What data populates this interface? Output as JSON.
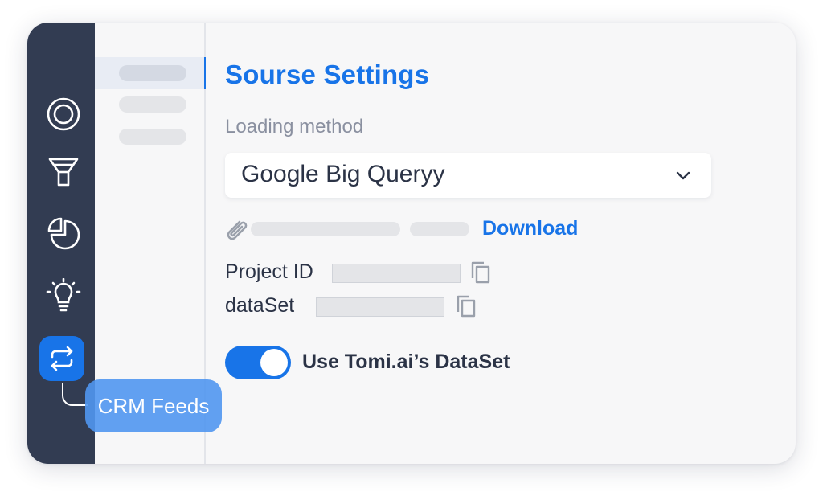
{
  "colors": {
    "accent": "#1874e8",
    "sidebar": "#323c52",
    "text": "#2b3346",
    "muted": "#8a90a0",
    "skeleton": "#e4e5e8"
  },
  "sidebar": {
    "icons": [
      "target-icon",
      "funnel-icon",
      "pie-chart-icon",
      "lightbulb-icon",
      "sync-arrows-icon"
    ],
    "active_index": 4,
    "tooltip": "CRM Feeds"
  },
  "main": {
    "title": "Sourse Settings",
    "loading_method_label": "Loading method",
    "loading_method_value": "Google Big Queryy",
    "download_link": "Download",
    "project_id_label": "Project ID",
    "dataset_label": "dataSet",
    "toggle_label": "Use Tomi.ai’s DataSet",
    "toggle_on": true
  }
}
